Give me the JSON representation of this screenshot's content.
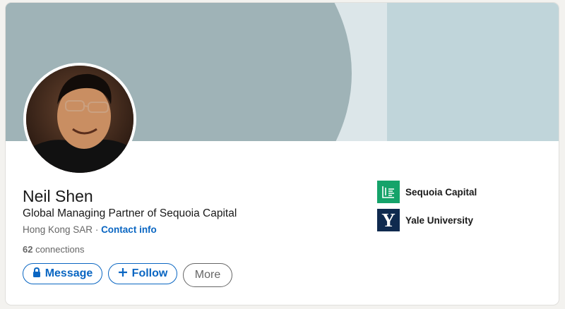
{
  "profile": {
    "name": "Neil Shen",
    "headline": "Global Managing Partner of Sequoia Capital",
    "location": "Hong Kong SAR",
    "location_separator": " · ",
    "contact_info": "Contact info",
    "connections_count": "62",
    "connections_label": " connections"
  },
  "actions": {
    "message": "Message",
    "follow": "Follow",
    "more": "More"
  },
  "experience": [
    {
      "name": "Sequoia Capital",
      "logo": "sequoia-logo"
    },
    {
      "name": "Yale University",
      "logo": "yale-logo",
      "logo_letter": "Y"
    }
  ],
  "colors": {
    "accent": "#0a66c2",
    "banner_light": "#c0d5da",
    "banner_dark": "#9fb3b7",
    "sequoia_green": "#15a36a",
    "yale_blue": "#0f2a4f"
  }
}
